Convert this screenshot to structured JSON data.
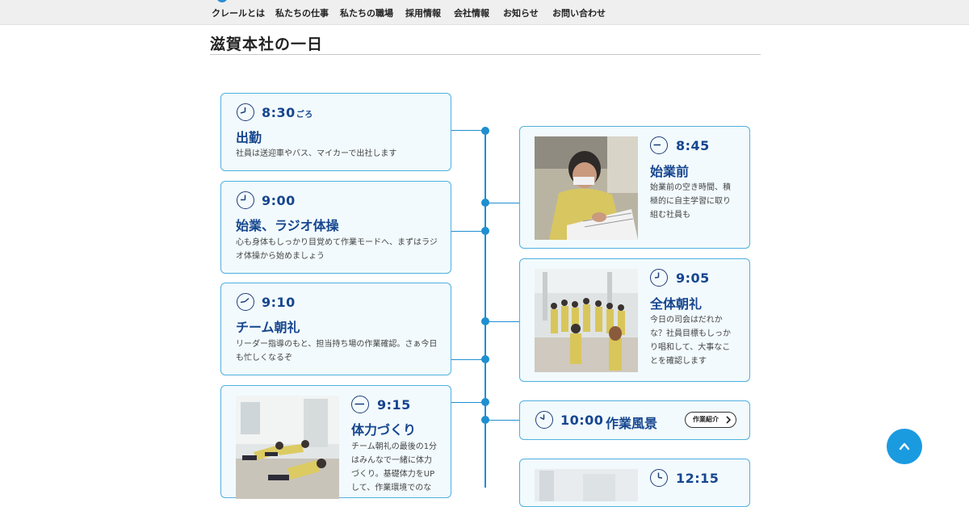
{
  "nav": {
    "items": [
      "クレールとは",
      "私たちの仕事",
      "私たちの職場",
      "採用情報",
      "会社情報",
      "お知らせ",
      "お問い合わせ"
    ]
  },
  "page": {
    "title": "滋賀本社の一日"
  },
  "timeline": {
    "card_830": {
      "time": "8:30",
      "suffix": "ごろ",
      "heading": "出勤",
      "desc": "社員は送迎車やバス、マイカーで出社します"
    },
    "card_845": {
      "time": "8:45",
      "heading": "始業前",
      "desc_lines": [
        "始業前の空き時間、積",
        "極的に自主学習に取り",
        "組む社員も"
      ]
    },
    "card_900": {
      "time": "9:00",
      "heading": "始業、ラジオ体操",
      "desc_lines": [
        "心も身体もしっかり目覚めて作業モードへ、まずはラジ",
        "オ体操から始めましょう"
      ]
    },
    "card_905": {
      "time": "9:05",
      "heading": "全体朝礼",
      "desc_lines": [
        "今日の司会はだれか",
        "な？社員目標もしっか",
        "り唱和して、大事なこ",
        "とを確認します"
      ]
    },
    "card_910": {
      "time": "9:10",
      "heading": "チーム朝礼",
      "desc_lines": [
        "リーダー指導のもと、担当持ち場の作業確認。さぁ今日",
        "も忙しくなるぞ"
      ]
    },
    "card_915": {
      "time": "9:15",
      "heading": "体力づくり",
      "desc_lines": [
        "チーム朝礼の最後の1分",
        "はみんなで一緒に体力",
        "づくり。基礎体力をUP",
        "して、作業環境でのな"
      ]
    },
    "card_1000": {
      "time": "10:00",
      "heading": "作業風景",
      "button": "作業紹介"
    },
    "card_1215": {
      "time": "12:15"
    }
  },
  "colors": {
    "accent": "#1e8fd0",
    "heading": "#16468f",
    "card_bg": "#f2fafd",
    "scroll_button": "#1a9be0"
  }
}
